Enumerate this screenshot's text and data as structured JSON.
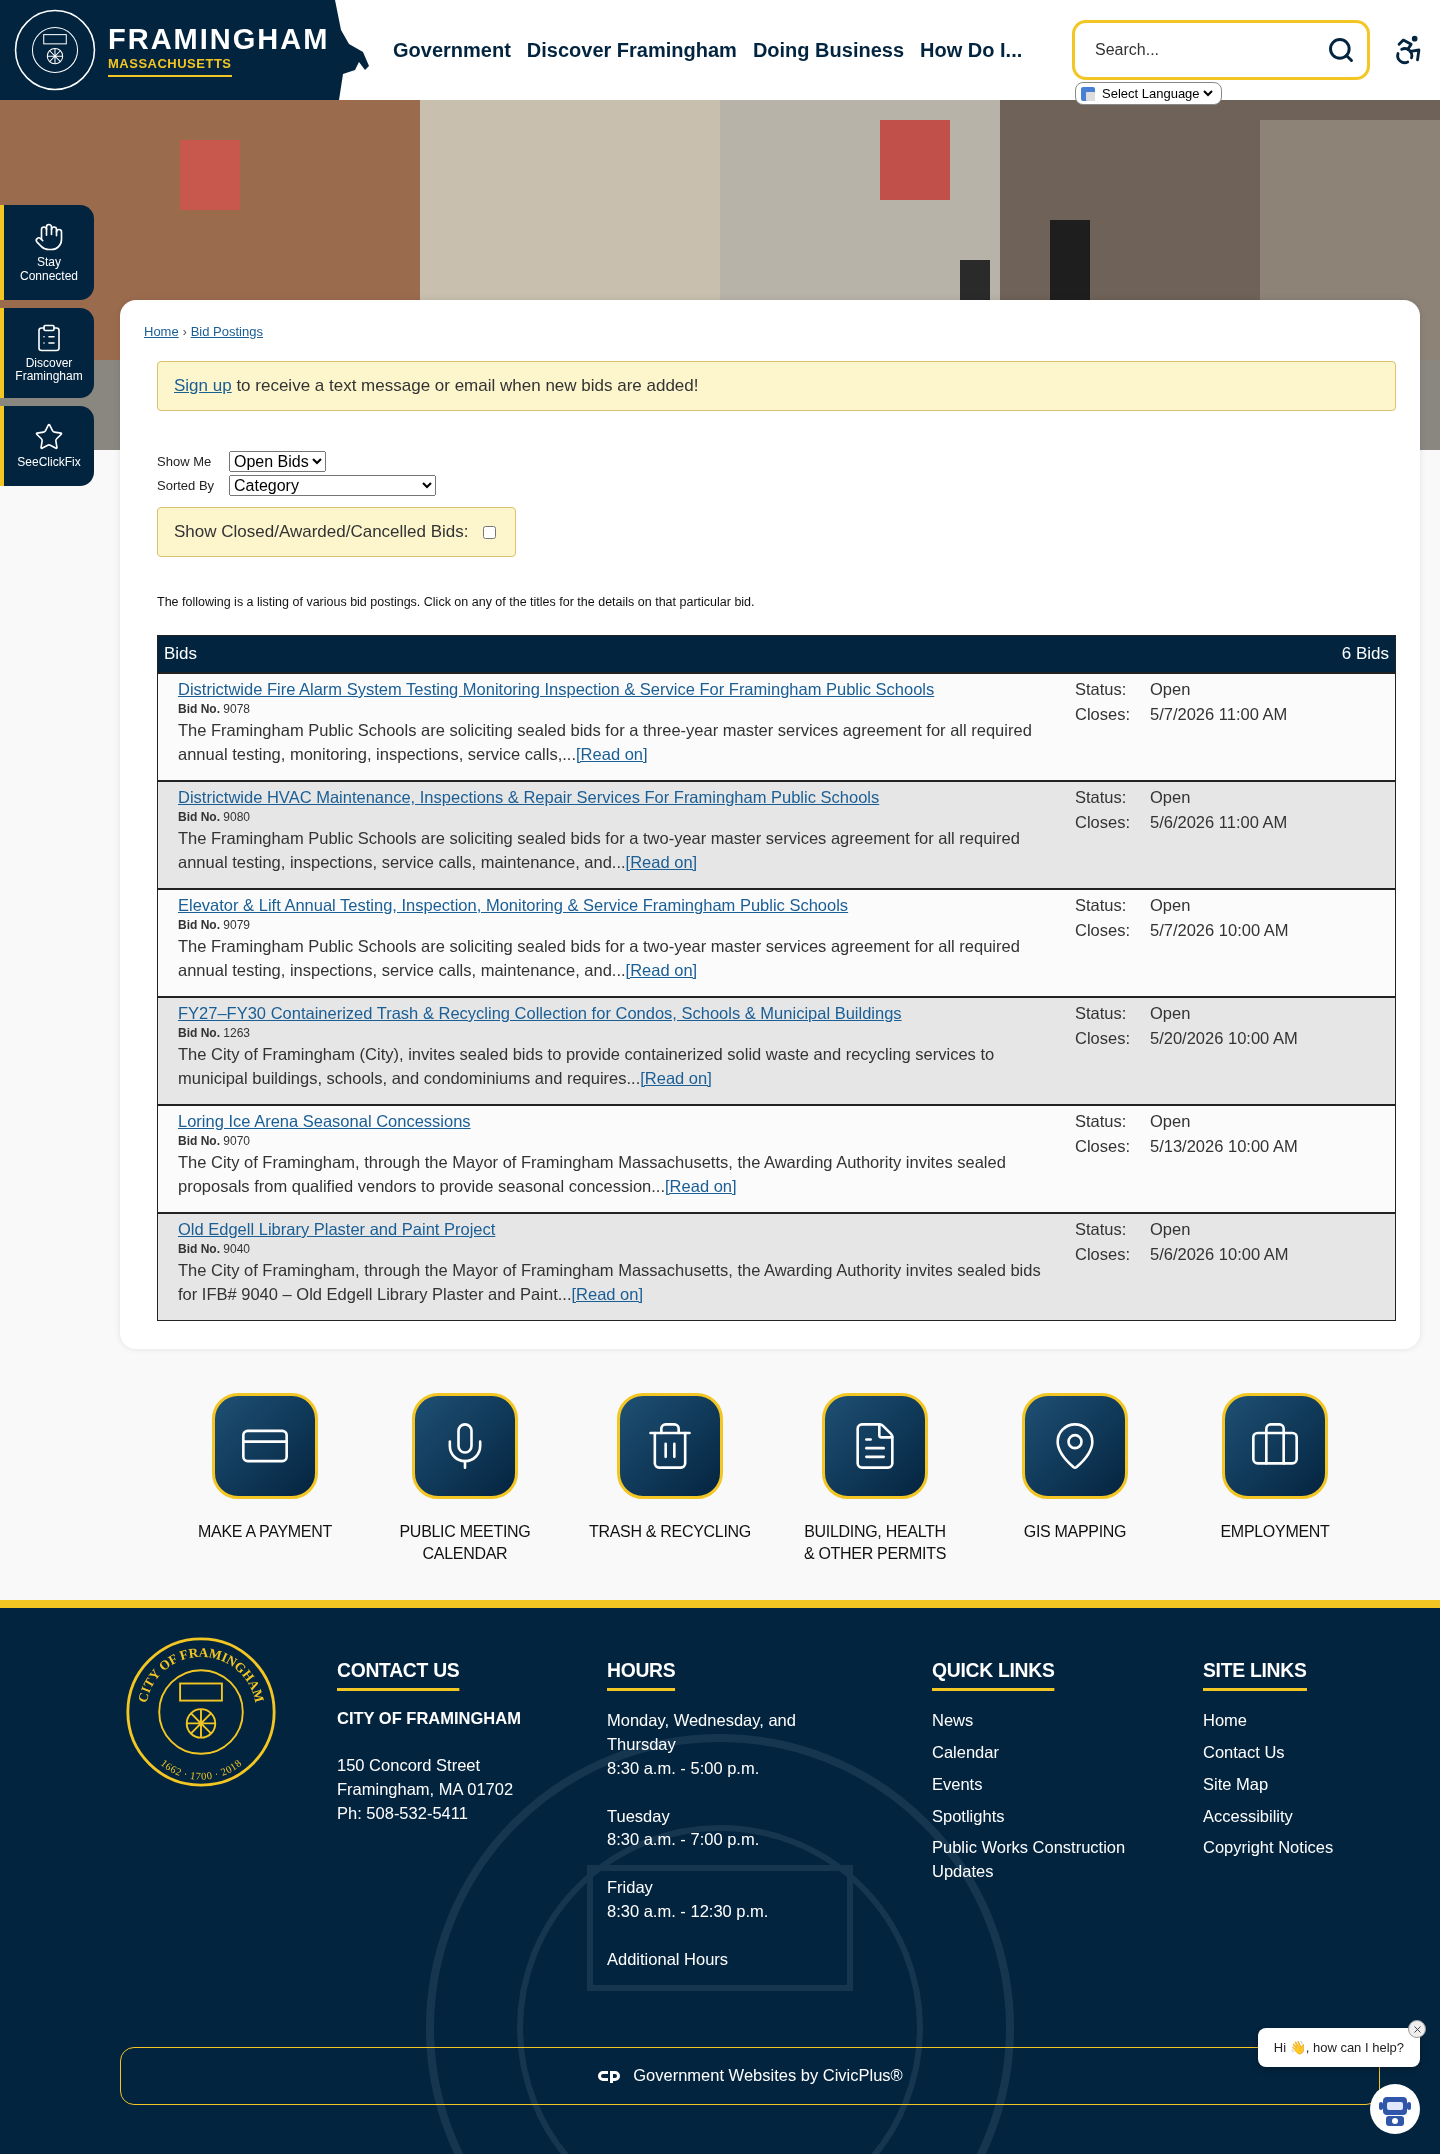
{
  "header": {
    "logo": {
      "title": "FRAMINGHAM",
      "subtitle": "MASSACHUSETTS"
    },
    "nav": [
      {
        "label": "Government"
      },
      {
        "label": "Discover Framingham"
      },
      {
        "label": "Doing Business"
      },
      {
        "label": "How Do I..."
      }
    ],
    "search": {
      "placeholder": "Search..."
    },
    "language": "Select Language"
  },
  "sidebar": [
    {
      "label": "Stay Connected"
    },
    {
      "label": "Discover Framingham"
    },
    {
      "label": "SeeClickFix"
    }
  ],
  "breadcrumb": {
    "items": [
      {
        "label": "Home"
      },
      {
        "label": "Bid Postings"
      }
    ],
    "separator": "›"
  },
  "notice": {
    "link": "Sign up",
    "text": " to receive a text message or email when new bids are added!"
  },
  "filters": {
    "show_me": {
      "label": "Show Me",
      "value": "Open Bids"
    },
    "sorted_by": {
      "label": "Sorted By",
      "value": "Category"
    },
    "closed": {
      "label": "Show Closed/Awarded/Cancelled Bids:",
      "checked": false
    }
  },
  "intro": "The following is a listing of various bid postings. Click on any of the titles for the details on that particular bid.",
  "bids": {
    "title": "Bids",
    "count": "6 Bids",
    "rows": [
      {
        "title": "Districtwide Fire Alarm System Testing Monitoring Inspection & Service For Framingham Public Schools",
        "bid_no_label": "Bid No.",
        "bid_no": "9078",
        "description": "The Framingham Public Schools are soliciting sealed bids for a three-year master services agreement for all required annual testing, monitoring, inspections, service calls,...",
        "read_on": "[Read on]",
        "status_label": "Status:",
        "status": "Open",
        "closes_label": "Closes:",
        "closes": "5/7/2026 11:00 AM"
      },
      {
        "title": "Districtwide HVAC Maintenance, Inspections & Repair Services For Framingham Public Schools",
        "bid_no_label": "Bid No.",
        "bid_no": "9080",
        "description": "The Framingham Public Schools are soliciting sealed bids for a two-year master services agreement for all required annual testing, inspections, service calls, maintenance, and...",
        "read_on": "[Read on]",
        "status_label": "Status:",
        "status": "Open",
        "closes_label": "Closes:",
        "closes": "5/6/2026 11:00 AM"
      },
      {
        "title": "Elevator & Lift Annual Testing, Inspection, Monitoring & Service Framingham Public Schools",
        "bid_no_label": "Bid No.",
        "bid_no": "9079",
        "description": "The Framingham Public Schools are soliciting sealed bids for a two-year master services agreement for all required annual testing, inspections, service calls, maintenance, and...",
        "read_on": "[Read on]",
        "status_label": "Status:",
        "status": "Open",
        "closes_label": "Closes:",
        "closes": "5/7/2026 10:00 AM"
      },
      {
        "title": "FY27–FY30 Containerized Trash & Recycling Collection for Condos, Schools & Municipal Buildings",
        "bid_no_label": "Bid No.",
        "bid_no": "1263",
        "description": "The City of Framingham (City), invites sealed bids to provide containerized solid waste and recycling services to municipal buildings, schools, and condominiums and requires...",
        "read_on": "[Read on]",
        "status_label": "Status:",
        "status": "Open",
        "closes_label": "Closes:",
        "closes": "5/20/2026 10:00 AM"
      },
      {
        "title": "Loring Ice Arena Seasonal Concessions",
        "bid_no_label": "Bid No.",
        "bid_no": "9070",
        "description": "The City of Framingham, through the Mayor of Framingham Massachusetts, the Awarding Authority invites sealed proposals from qualified vendors to provide seasonal concession...",
        "read_on": "[Read on]",
        "status_label": "Status:",
        "status": "Open",
        "closes_label": "Closes:",
        "closes": "5/13/2026 10:00 AM"
      },
      {
        "title": "Old Edgell Library Plaster and Paint Project",
        "bid_no_label": "Bid No.",
        "bid_no": "9040",
        "description": "The City of Framingham, through the Mayor of Framingham Massachusetts, the Awarding Authority invites sealed bids for IFB# 9040 – Old Edgell Library Plaster and Paint...",
        "read_on": "[Read on]",
        "status_label": "Status:",
        "status": "Open",
        "closes_label": "Closes:",
        "closes": "5/6/2026 10:00 AM"
      }
    ]
  },
  "quick_links": [
    {
      "lines": [
        "MAKE A PAYMENT"
      ]
    },
    {
      "lines": [
        "PUBLIC MEETING",
        "CALENDAR"
      ]
    },
    {
      "lines": [
        "TRASH & RECYCLING"
      ]
    },
    {
      "lines": [
        "BUILDING, HEALTH",
        "& OTHER PERMITS"
      ]
    },
    {
      "lines": [
        "GIS MAPPING"
      ]
    },
    {
      "lines": [
        "EMPLOYMENT"
      ]
    }
  ],
  "footer": {
    "seal": {
      "ring_text": "CITY OF FRAMINGHAM",
      "years": "1662 · 1700 · 2018"
    },
    "contact": {
      "heading": "CONTACT US",
      "name": "CITY OF FRAMINGHAM",
      "lines": [
        "150 Concord Street",
        "Framingham, MA 01702",
        "Ph: 508-532-5411"
      ]
    },
    "hours": {
      "heading": "HOURS",
      "groups": [
        {
          "day": "Monday, Wednesday, and Thursday",
          "time": "8:30 a.m. - 5:00 p.m."
        },
        {
          "day": "Tuesday",
          "time": "8:30 a.m. - 7:00 p.m."
        },
        {
          "day": "Friday",
          "time": "8:30 a.m. - 12:30 p.m."
        }
      ],
      "more": "Additional Hours"
    },
    "quick_links": {
      "heading": "QUICK LINKS",
      "items": [
        "News",
        "Calendar",
        "Events",
        "Spotlights",
        "Public Works Construction Updates"
      ]
    },
    "site_links": {
      "heading": "SITE LINKS",
      "items": [
        "Home",
        "Contact Us",
        "Site Map",
        "Accessibility",
        "Copyright Notices"
      ]
    },
    "credit": "Government Websites by CivicPlus®"
  },
  "chat": {
    "message": "Hi 👋, how can I help?"
  }
}
